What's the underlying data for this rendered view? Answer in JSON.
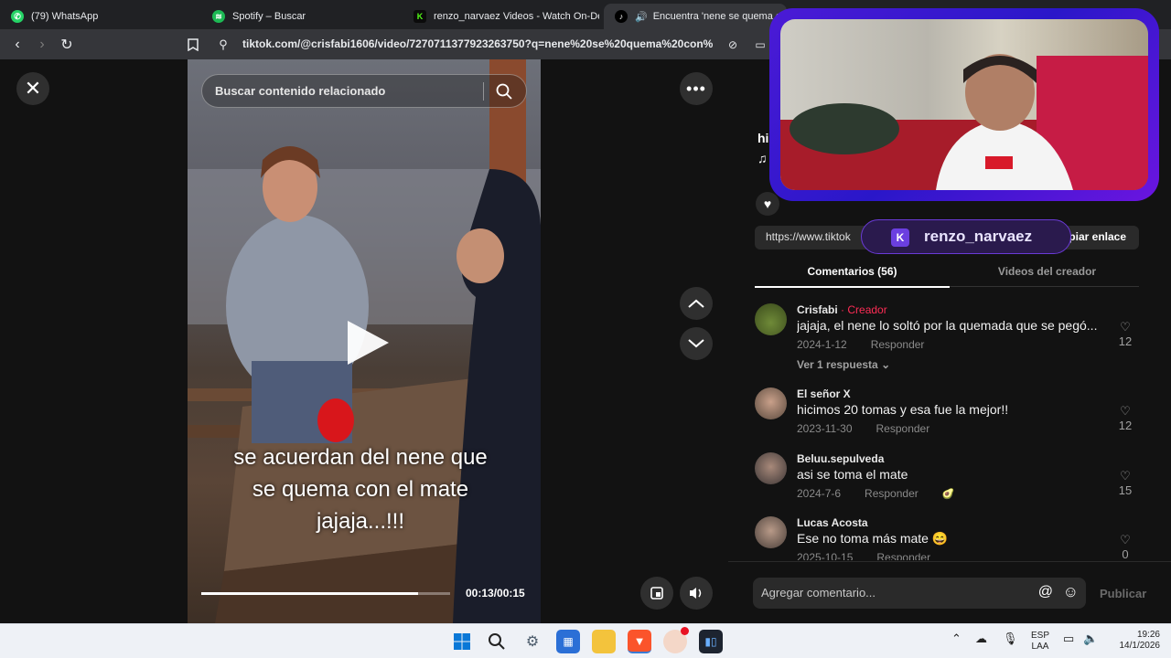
{
  "browser": {
    "tabs": [
      {
        "title": "(79) WhatsApp",
        "icon": "whatsapp-icon",
        "color": "#25d366"
      },
      {
        "title": "Spotify – Buscar",
        "icon": "spotify-icon",
        "color": "#1db954"
      },
      {
        "title": "renzo_narvaez Videos - Watch On-De",
        "icon": "kick-icon",
        "color": "#53fc18"
      },
      {
        "title": "Encuentra 'nene se quema co",
        "icon": "tiktok-icon",
        "color": "#ffffff"
      }
    ],
    "url": "tiktok.com/@crisfabi1606/video/7270711377923263750?q=nene%20se%20quema%20con%"
  },
  "player": {
    "search_placeholder": "Buscar contenido relacionado",
    "caption_lines": [
      "se acuerdan del nene que",
      "se quema con el mate",
      "jajaja...!!!"
    ],
    "time": "00:13/00:15",
    "progress": 0.87
  },
  "panel": {
    "header_snip_1": "hi",
    "header_snip_2": "♫",
    "link_text": "https://www.tiktok",
    "copy_label": "piar enlace",
    "tabs": [
      "Comentarios (56)",
      "Videos del creador"
    ],
    "comments": [
      {
        "user": "Crisfabi",
        "badge": "· Creador",
        "text": "jajaja, el nene lo soltó por la quemada que se pegó...",
        "date": "2024-1-12",
        "reply": "Responder",
        "likes": "12",
        "more": "Ver 1 respuesta"
      },
      {
        "user": "El señor X",
        "badge": "",
        "text": "hicimos 20 tomas y esa fue la mejor!!",
        "date": "2023-11-30",
        "reply": "Responder",
        "likes": "12",
        "more": ""
      },
      {
        "user": "Beluu.sepulveda",
        "badge": "",
        "text": "asi se toma el mate",
        "date": "2024-7-6",
        "reply": "Responder",
        "likes": "15",
        "more": ""
      },
      {
        "user": "Lucas Acosta",
        "badge": "",
        "text": "Ese no toma más mate 😄",
        "date": "2025-10-15",
        "reply": "Responder",
        "likes": "0",
        "more": ""
      }
    ],
    "comment_placeholder": "Agregar comentario...",
    "publish_label": "Publicar"
  },
  "overlay": {
    "streamer": "renzo_narvaez"
  },
  "taskbar": {
    "lang_1": "ESP",
    "lang_2": "LAA",
    "time": "19:26",
    "date": "14/1/2026"
  }
}
